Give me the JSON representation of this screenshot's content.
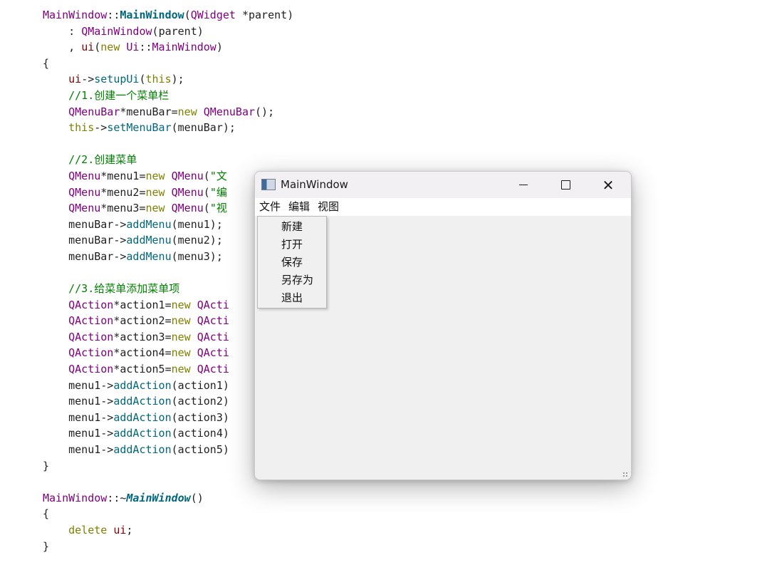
{
  "code_lines": [
    [
      {
        "t": "MainWindow",
        "c": "class"
      },
      {
        "t": "::",
        "c": "plain"
      },
      {
        "t": "MainWindow",
        "c": "bold"
      },
      {
        "t": "(",
        "c": "plain"
      },
      {
        "t": "QWidget",
        "c": "class"
      },
      {
        "t": " *",
        "c": "plain"
      },
      {
        "t": "parent",
        "c": "plain"
      },
      {
        "t": ")",
        "c": "plain"
      }
    ],
    [
      {
        "t": "    : ",
        "c": "plain"
      },
      {
        "t": "QMainWindow",
        "c": "class"
      },
      {
        "t": "(",
        "c": "plain"
      },
      {
        "t": "parent",
        "c": "plain"
      },
      {
        "t": ")",
        "c": "plain"
      }
    ],
    [
      {
        "t": "    , ",
        "c": "plain"
      },
      {
        "t": "ui",
        "c": "member"
      },
      {
        "t": "(",
        "c": "plain"
      },
      {
        "t": "new",
        "c": "keyword"
      },
      {
        "t": " ",
        "c": "plain"
      },
      {
        "t": "Ui",
        "c": "class"
      },
      {
        "t": "::",
        "c": "plain"
      },
      {
        "t": "MainWindow",
        "c": "class"
      },
      {
        "t": ")",
        "c": "plain"
      }
    ],
    [
      {
        "t": "{",
        "c": "plain"
      }
    ],
    [
      {
        "t": "    ",
        "c": "plain"
      },
      {
        "t": "ui",
        "c": "member"
      },
      {
        "t": "->",
        "c": "plain"
      },
      {
        "t": "setupUi",
        "c": "method"
      },
      {
        "t": "(",
        "c": "plain"
      },
      {
        "t": "this",
        "c": "keyword"
      },
      {
        "t": ");",
        "c": "plain"
      }
    ],
    [
      {
        "t": "    //1.创建一个菜单栏",
        "c": "comment"
      }
    ],
    [
      {
        "t": "    ",
        "c": "plain"
      },
      {
        "t": "QMenuBar",
        "c": "class"
      },
      {
        "t": "*menuBar=",
        "c": "plain"
      },
      {
        "t": "new",
        "c": "keyword"
      },
      {
        "t": " ",
        "c": "plain"
      },
      {
        "t": "QMenuBar",
        "c": "class"
      },
      {
        "t": "();",
        "c": "plain"
      }
    ],
    [
      {
        "t": "    ",
        "c": "plain"
      },
      {
        "t": "this",
        "c": "keyword"
      },
      {
        "t": "->",
        "c": "plain"
      },
      {
        "t": "setMenuBar",
        "c": "method"
      },
      {
        "t": "(menuBar);",
        "c": "plain"
      }
    ],
    [
      {
        "t": "",
        "c": "plain"
      }
    ],
    [
      {
        "t": "    //2.创建菜单",
        "c": "comment"
      }
    ],
    [
      {
        "t": "    ",
        "c": "plain"
      },
      {
        "t": "QMenu",
        "c": "class"
      },
      {
        "t": "*menu1=",
        "c": "plain"
      },
      {
        "t": "new",
        "c": "keyword"
      },
      {
        "t": " ",
        "c": "plain"
      },
      {
        "t": "QMenu",
        "c": "class"
      },
      {
        "t": "(",
        "c": "plain"
      },
      {
        "t": "\"文",
        "c": "string"
      }
    ],
    [
      {
        "t": "    ",
        "c": "plain"
      },
      {
        "t": "QMenu",
        "c": "class"
      },
      {
        "t": "*menu2=",
        "c": "plain"
      },
      {
        "t": "new",
        "c": "keyword"
      },
      {
        "t": " ",
        "c": "plain"
      },
      {
        "t": "QMenu",
        "c": "class"
      },
      {
        "t": "(",
        "c": "plain"
      },
      {
        "t": "\"编",
        "c": "string"
      }
    ],
    [
      {
        "t": "    ",
        "c": "plain"
      },
      {
        "t": "QMenu",
        "c": "class"
      },
      {
        "t": "*menu3=",
        "c": "plain"
      },
      {
        "t": "new",
        "c": "keyword"
      },
      {
        "t": " ",
        "c": "plain"
      },
      {
        "t": "QMenu",
        "c": "class"
      },
      {
        "t": "(",
        "c": "plain"
      },
      {
        "t": "\"视",
        "c": "string"
      }
    ],
    [
      {
        "t": "    menuBar->",
        "c": "plain"
      },
      {
        "t": "addMenu",
        "c": "method"
      },
      {
        "t": "(menu1);",
        "c": "plain"
      }
    ],
    [
      {
        "t": "    menuBar->",
        "c": "plain"
      },
      {
        "t": "addMenu",
        "c": "method"
      },
      {
        "t": "(menu2);",
        "c": "plain"
      }
    ],
    [
      {
        "t": "    menuBar->",
        "c": "plain"
      },
      {
        "t": "addMenu",
        "c": "method"
      },
      {
        "t": "(menu3);",
        "c": "plain"
      }
    ],
    [
      {
        "t": "",
        "c": "plain"
      }
    ],
    [
      {
        "t": "    //3.给菜单添加菜单项",
        "c": "comment"
      }
    ],
    [
      {
        "t": "    ",
        "c": "plain"
      },
      {
        "t": "QAction",
        "c": "class"
      },
      {
        "t": "*action1=",
        "c": "plain"
      },
      {
        "t": "new",
        "c": "keyword"
      },
      {
        "t": " ",
        "c": "plain"
      },
      {
        "t": "QActi",
        "c": "class"
      }
    ],
    [
      {
        "t": "    ",
        "c": "plain"
      },
      {
        "t": "QAction",
        "c": "class"
      },
      {
        "t": "*action2=",
        "c": "plain"
      },
      {
        "t": "new",
        "c": "keyword"
      },
      {
        "t": " ",
        "c": "plain"
      },
      {
        "t": "QActi",
        "c": "class"
      }
    ],
    [
      {
        "t": "    ",
        "c": "plain"
      },
      {
        "t": "QAction",
        "c": "class"
      },
      {
        "t": "*action3=",
        "c": "plain"
      },
      {
        "t": "new",
        "c": "keyword"
      },
      {
        "t": " ",
        "c": "plain"
      },
      {
        "t": "QActi",
        "c": "class"
      }
    ],
    [
      {
        "t": "    ",
        "c": "plain"
      },
      {
        "t": "QAction",
        "c": "class"
      },
      {
        "t": "*action4=",
        "c": "plain"
      },
      {
        "t": "new",
        "c": "keyword"
      },
      {
        "t": " ",
        "c": "plain"
      },
      {
        "t": "QActi",
        "c": "class"
      }
    ],
    [
      {
        "t": "    ",
        "c": "plain"
      },
      {
        "t": "QAction",
        "c": "class"
      },
      {
        "t": "*action5=",
        "c": "plain"
      },
      {
        "t": "new",
        "c": "keyword"
      },
      {
        "t": " ",
        "c": "plain"
      },
      {
        "t": "QActi",
        "c": "class"
      }
    ],
    [
      {
        "t": "    menu1->",
        "c": "plain"
      },
      {
        "t": "addAction",
        "c": "method"
      },
      {
        "t": "(action1)",
        "c": "plain"
      }
    ],
    [
      {
        "t": "    menu1->",
        "c": "plain"
      },
      {
        "t": "addAction",
        "c": "method"
      },
      {
        "t": "(action2)",
        "c": "plain"
      }
    ],
    [
      {
        "t": "    menu1->",
        "c": "plain"
      },
      {
        "t": "addAction",
        "c": "method"
      },
      {
        "t": "(action3)",
        "c": "plain"
      }
    ],
    [
      {
        "t": "    menu1->",
        "c": "plain"
      },
      {
        "t": "addAction",
        "c": "method"
      },
      {
        "t": "(action4)",
        "c": "plain"
      }
    ],
    [
      {
        "t": "    menu1->",
        "c": "plain"
      },
      {
        "t": "addAction",
        "c": "method"
      },
      {
        "t": "(action5)",
        "c": "plain"
      }
    ],
    [
      {
        "t": "}",
        "c": "plain"
      }
    ],
    [
      {
        "t": "",
        "c": "plain"
      }
    ],
    [
      {
        "t": "MainWindow",
        "c": "class"
      },
      {
        "t": "::~",
        "c": "plain"
      },
      {
        "t": "MainWindow",
        "c": "bolditalic"
      },
      {
        "t": "()",
        "c": "plain"
      }
    ],
    [
      {
        "t": "{",
        "c": "plain"
      }
    ],
    [
      {
        "t": "    ",
        "c": "plain"
      },
      {
        "t": "delete",
        "c": "keyword"
      },
      {
        "t": " ",
        "c": "plain"
      },
      {
        "t": "ui",
        "c": "member"
      },
      {
        "t": ";",
        "c": "plain"
      }
    ],
    [
      {
        "t": "}",
        "c": "plain"
      }
    ]
  ],
  "window": {
    "title": "MainWindow",
    "icon": "qt-app-window-icon",
    "minimize_icon": "minimize-icon",
    "maximize_icon": "maximize-icon",
    "close_icon": "close-icon",
    "close_glyph": "✕"
  },
  "menu_bar": {
    "items": [
      {
        "label": "文件"
      },
      {
        "label": "编辑"
      },
      {
        "label": "视图"
      }
    ]
  },
  "file_menu": {
    "items": [
      {
        "label": "新建"
      },
      {
        "label": "打开"
      },
      {
        "label": "保存"
      },
      {
        "label": "另存为"
      },
      {
        "label": "退出"
      }
    ]
  },
  "colors": {
    "background": "#ffffff",
    "window_bg": "#f0f0f0",
    "title_bar_bg": "#f3f0f4",
    "menu_bar_bg": "#ffffff",
    "code_class": "#800080",
    "code_keyword": "#808000",
    "code_method": "#00677c",
    "code_comment": "#008000"
  }
}
